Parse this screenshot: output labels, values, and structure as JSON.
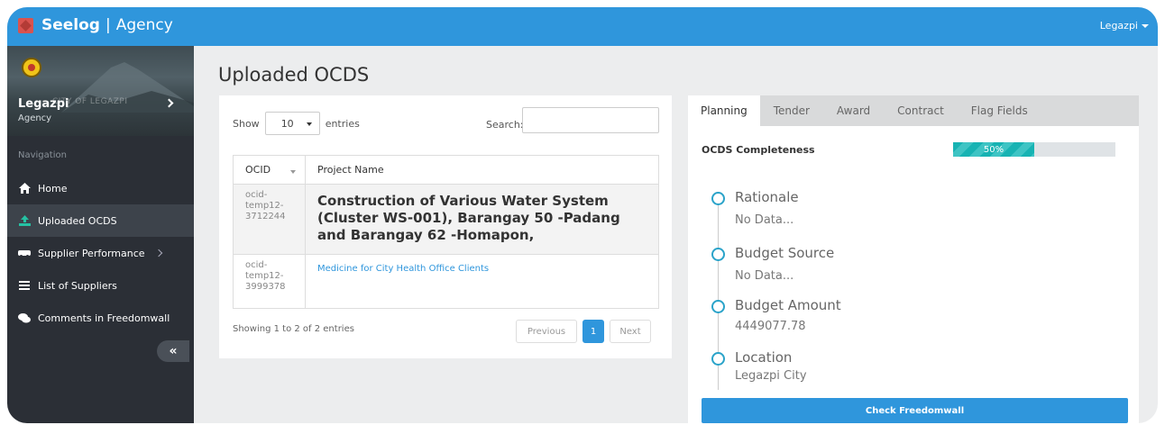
{
  "app": {
    "name": "Seelog",
    "separator": "|",
    "section": "Agency"
  },
  "user_menu": {
    "label": "Legazpi"
  },
  "sidebar": {
    "profile": {
      "watermark": "CITY OF LEGAZPI",
      "name": "Legazpi",
      "role": "Agency"
    },
    "nav_heading": "Navigation",
    "items": [
      {
        "label": "Home",
        "icon": "home-icon"
      },
      {
        "label": "Uploaded OCDS",
        "icon": "upload-icon",
        "active": true
      },
      {
        "label": "Supplier Performance",
        "icon": "truck-icon",
        "has_submenu": true
      },
      {
        "label": "List of Suppliers",
        "icon": "list-icon"
      },
      {
        "label": "Comments in Freedomwall",
        "icon": "comments-icon"
      }
    ],
    "collapse_label": "«"
  },
  "main": {
    "title": "Uploaded OCDS"
  },
  "table_panel": {
    "show_label": "Show",
    "entries_value": "10",
    "entries_label": "entries",
    "search_label": "Search:",
    "search_value": "",
    "columns": [
      "OCID",
      "Project Name"
    ],
    "rows": [
      {
        "ocid_lines": [
          "ocid-",
          "temp12-",
          "3712244"
        ],
        "project": "Construction of Various Water System (Cluster WS-001), Barangay 50 -Padang and Barangay 62 -Homapon,"
      },
      {
        "ocid_lines": [
          "ocid-",
          "temp12-",
          "3999378"
        ],
        "project": "Medicine for City Health Office Clients"
      }
    ],
    "info": "Showing 1 to 2 of 2 entries",
    "pagination": {
      "previous": "Previous",
      "current": "1",
      "next": "Next"
    }
  },
  "detail_panel": {
    "tabs": [
      "Planning",
      "Tender",
      "Award",
      "Contract",
      "Flag Fields"
    ],
    "active_tab": "Planning",
    "completeness": {
      "label": "OCDS Completeness",
      "value": 0.5,
      "text": "50%"
    },
    "fields": [
      {
        "title": "Rationale",
        "value": "No Data..."
      },
      {
        "title": "Budget Source",
        "value": "No Data..."
      },
      {
        "title": "Budget Amount",
        "value": "4449077.78"
      },
      {
        "title": "Location",
        "value": "Legazpi City"
      }
    ],
    "button": "Check Freedomwall"
  },
  "colors": {
    "primary": "#2f96dc",
    "sidebar": "#2b2f36",
    "progress": "#17b3b3",
    "timeline": "#2aa3c9"
  }
}
